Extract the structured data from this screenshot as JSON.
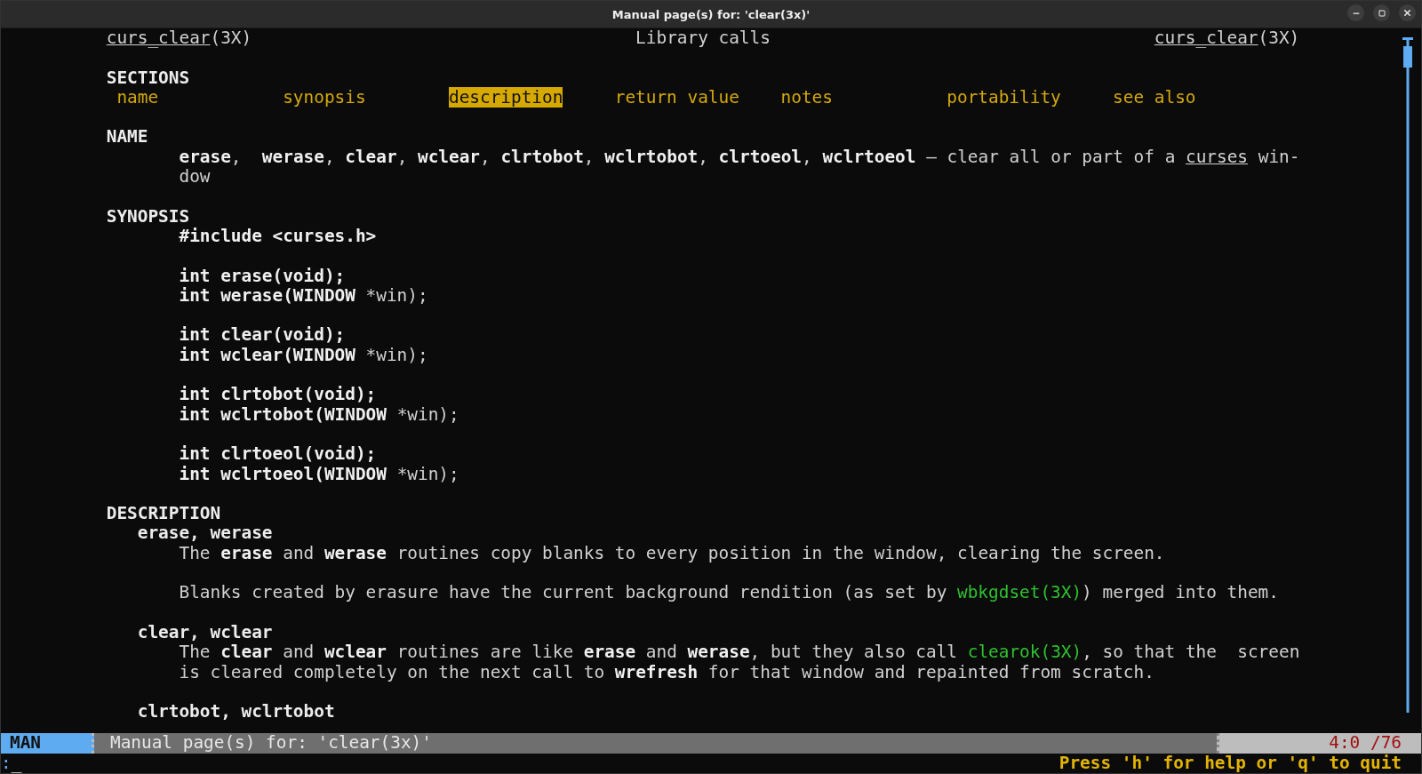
{
  "window": {
    "title": "Manual page(s) for: 'clear(3x)'"
  },
  "header": {
    "left": {
      "name": "curs_clear",
      "suffix": "(3X)"
    },
    "center": "Library calls",
    "right": {
      "name": "curs_clear",
      "suffix": "(3X)"
    }
  },
  "lines": [
    {
      "kind": "blank"
    },
    {
      "kind": "heading",
      "text": "SECTIONS"
    },
    {
      "kind": "sections",
      "items": [
        {
          "label": "name",
          "selected": false
        },
        {
          "label": "synopsis",
          "selected": false
        },
        {
          "label": "description",
          "selected": true
        },
        {
          "label": "return value",
          "selected": false
        },
        {
          "label": "notes",
          "selected": false
        },
        {
          "label": "portability",
          "selected": false
        },
        {
          "label": "see also",
          "selected": false
        }
      ]
    },
    {
      "kind": "blank"
    },
    {
      "kind": "heading",
      "text": "NAME"
    },
    {
      "kind": "body",
      "segments": [
        {
          "text": "erase",
          "kind": "bold"
        },
        {
          "text": ",  ",
          "kind": "plain"
        },
        {
          "text": "werase",
          "kind": "bold"
        },
        {
          "text": ", ",
          "kind": "plain"
        },
        {
          "text": "clear",
          "kind": "bold"
        },
        {
          "text": ", ",
          "kind": "plain"
        },
        {
          "text": "wclear",
          "kind": "bold"
        },
        {
          "text": ", ",
          "kind": "plain"
        },
        {
          "text": "clrtobot",
          "kind": "bold"
        },
        {
          "text": ", ",
          "kind": "plain"
        },
        {
          "text": "wclrtobot",
          "kind": "bold"
        },
        {
          "text": ", ",
          "kind": "plain"
        },
        {
          "text": "clrtoeol",
          "kind": "bold"
        },
        {
          "text": ", ",
          "kind": "plain"
        },
        {
          "text": "wclrtoeol",
          "kind": "bold"
        },
        {
          "text": " – clear all or part of a ",
          "kind": "plain"
        },
        {
          "text": "curses",
          "kind": "underline"
        },
        {
          "text": " win-",
          "kind": "plain"
        }
      ]
    },
    {
      "kind": "body",
      "segments": [
        {
          "text": "dow",
          "kind": "plain"
        }
      ]
    },
    {
      "kind": "blank"
    },
    {
      "kind": "heading",
      "text": "SYNOPSIS"
    },
    {
      "kind": "body",
      "segments": [
        {
          "text": "#include <curses.h>",
          "kind": "bold"
        }
      ]
    },
    {
      "kind": "blank"
    },
    {
      "kind": "body",
      "segments": [
        {
          "text": "int erase(void);",
          "kind": "bold"
        }
      ]
    },
    {
      "kind": "body",
      "segments": [
        {
          "text": "int werase(WINDOW ",
          "kind": "bold"
        },
        {
          "text": "*win);",
          "kind": "plain"
        }
      ]
    },
    {
      "kind": "blank"
    },
    {
      "kind": "body",
      "segments": [
        {
          "text": "int clear(void);",
          "kind": "bold"
        }
      ]
    },
    {
      "kind": "body",
      "segments": [
        {
          "text": "int wclear(WINDOW ",
          "kind": "bold"
        },
        {
          "text": "*win);",
          "kind": "plain"
        }
      ]
    },
    {
      "kind": "blank"
    },
    {
      "kind": "body",
      "segments": [
        {
          "text": "int clrtobot(void);",
          "kind": "bold"
        }
      ]
    },
    {
      "kind": "body",
      "segments": [
        {
          "text": "int wclrtobot(WINDOW ",
          "kind": "bold"
        },
        {
          "text": "*win);",
          "kind": "plain"
        }
      ]
    },
    {
      "kind": "blank"
    },
    {
      "kind": "body",
      "segments": [
        {
          "text": "int clrtoeol(void);",
          "kind": "bold"
        }
      ]
    },
    {
      "kind": "body",
      "segments": [
        {
          "text": "int wclrtoeol(WINDOW ",
          "kind": "bold"
        },
        {
          "text": "*win);",
          "kind": "plain"
        }
      ]
    },
    {
      "kind": "blank"
    },
    {
      "kind": "heading",
      "text": "DESCRIPTION"
    },
    {
      "kind": "subheading",
      "text": "erase, werase"
    },
    {
      "kind": "body",
      "segments": [
        {
          "text": "The ",
          "kind": "plain"
        },
        {
          "text": "erase",
          "kind": "bold"
        },
        {
          "text": " and ",
          "kind": "plain"
        },
        {
          "text": "werase",
          "kind": "bold"
        },
        {
          "text": " routines copy blanks to every position in the window, clearing the screen.",
          "kind": "plain"
        }
      ]
    },
    {
      "kind": "blank"
    },
    {
      "kind": "body",
      "segments": [
        {
          "text": "Blanks created by erasure have the current background rendition (as set by ",
          "kind": "plain"
        },
        {
          "text": "wbkgdset(3X)",
          "kind": "link"
        },
        {
          "text": ") merged into them.",
          "kind": "plain"
        }
      ]
    },
    {
      "kind": "blank"
    },
    {
      "kind": "subheading",
      "text": "clear, wclear"
    },
    {
      "kind": "body",
      "segments": [
        {
          "text": "The ",
          "kind": "plain"
        },
        {
          "text": "clear",
          "kind": "bold"
        },
        {
          "text": " and ",
          "kind": "plain"
        },
        {
          "text": "wclear",
          "kind": "bold"
        },
        {
          "text": " routines are like ",
          "kind": "plain"
        },
        {
          "text": "erase",
          "kind": "bold"
        },
        {
          "text": " and ",
          "kind": "plain"
        },
        {
          "text": "werase",
          "kind": "bold"
        },
        {
          "text": ", but they also call ",
          "kind": "plain"
        },
        {
          "text": "clearok(3X)",
          "kind": "link"
        },
        {
          "text": ", so that the  screen",
          "kind": "plain"
        }
      ]
    },
    {
      "kind": "body",
      "segments": [
        {
          "text": "is cleared completely on the next call to ",
          "kind": "plain"
        },
        {
          "text": "wrefresh",
          "kind": "bold"
        },
        {
          "text": " for that window and repainted from scratch.",
          "kind": "plain"
        }
      ]
    },
    {
      "kind": "blank"
    },
    {
      "kind": "subheading",
      "text": "clrtobot, wclrtobot"
    }
  ],
  "status_bar": {
    "mode": "MAN",
    "message": "Manual page(s) for: 'clear(3x)'",
    "position": "4:0 /76"
  },
  "command_line": {
    "prompt": ":",
    "cursor": "_",
    "hint": "Press 'h' for help or 'q' to quit"
  }
}
